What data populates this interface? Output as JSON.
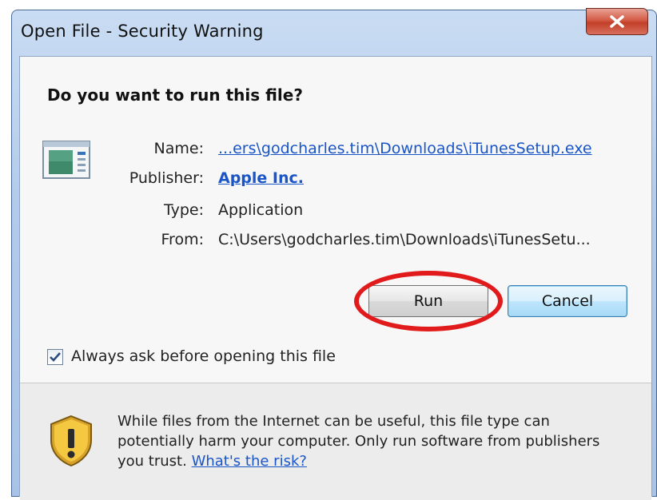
{
  "window": {
    "title": "Open File - Security Warning",
    "close_icon": "close-x-icon"
  },
  "dialog": {
    "question": "Do you want to run this file?",
    "file_icon": "application-file-icon",
    "fields": {
      "name_label": "Name:",
      "name_value": "...ers\\godcharles.tim\\Downloads\\iTunesSetup.exe",
      "publisher_label": "Publisher:",
      "publisher_value": "Apple Inc.",
      "type_label": "Type:",
      "type_value": "Application",
      "from_label": "From:",
      "from_value": "C:\\Users\\godcharles.tim\\Downloads\\iTunesSetu..."
    },
    "buttons": {
      "run": "Run",
      "cancel": "Cancel"
    },
    "checkbox": {
      "label": "Always ask before opening this file",
      "checked": true
    }
  },
  "footer": {
    "shield_icon": "warning-shield-icon",
    "warning_text": "While files from the Internet can be useful, this file type can potentially harm your computer. Only run software from publishers you trust.",
    "risk_link": "What's the risk?"
  },
  "colors": {
    "link": "#1a55c8",
    "highlight_ring": "#e11b1b",
    "close_button": "#c23f29"
  }
}
